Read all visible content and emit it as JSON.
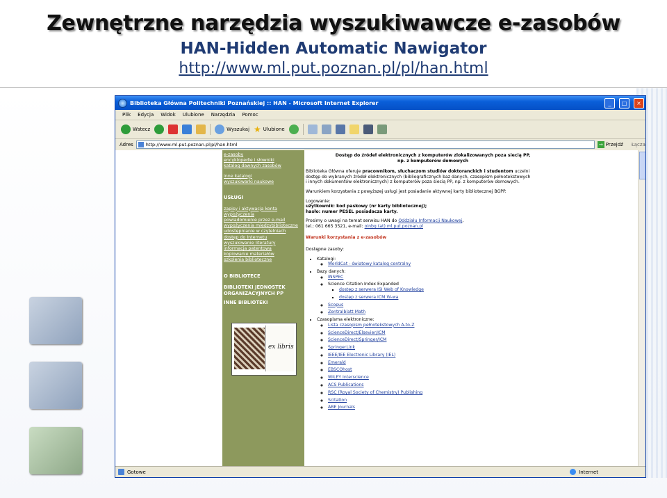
{
  "slide": {
    "title": "Zewnętrzne narzędzia wyszukiwawcze e-zasobów",
    "subtitle": "HAN-Hidden Automatic Nawigator",
    "url": "http://www.ml.put.poznan.pl/pl/han.html"
  },
  "browser": {
    "title": "Biblioteka Główna Politechniki Poznańskiej :: HAN - Microsoft Internet Explorer",
    "menu": [
      "Plik",
      "Edycja",
      "Widok",
      "Ulubione",
      "Narzędzia",
      "Pomoc"
    ],
    "toolbar": {
      "back": "Wstecz",
      "search": "Wyszukaj",
      "favorites": "Ulubione"
    },
    "address_label": "Adres",
    "address_value": "http://www.ml.put.poznan.pl/pl/han.html",
    "go_label": "Przejdź",
    "links_label": "Łącza",
    "status_left": "Gotowe",
    "status_right": "Internet"
  },
  "sidebar": {
    "top_links": [
      "e-zasoby",
      "encyklopedie i słowniki",
      "katalog dawnych zasobów"
    ],
    "mid_links": [
      "inne katalogi",
      "wyszukiwarki naukowe"
    ],
    "uslugi_header": "USŁUGI",
    "uslugi_links": [
      "zapisy i aktywacja konta",
      "wypożyczenia",
      "powiadomienie przez e-mail",
      "wypożyczenia międzybiblioteczne",
      "udostępnianie w czytelniach",
      "dostęp do Internetu",
      "wyszukiwanie literatury",
      "informacja patentowa",
      "kopiowanie materiałów",
      "szkolenia biblioteczne"
    ],
    "section_headers": [
      "O BIBLIOTECE",
      "BIBLIOTEKI JEDNOSTEK ORGANIZACYJNYCH PP",
      "INNE BIBLIOTEKI"
    ],
    "exlibris": "ex libris"
  },
  "content": {
    "notice": "Dostęp do źródeł elektronicznych z komputerów zlokalizowanych poza siecią PP, np. z komputerów domowych",
    "intro_pre": "Biblioteka Główna oferuje ",
    "intro_bold": "pracownikom, słuchaczom studiów doktoranckich i studentom",
    "intro_post": " uczelni dostęp do wybranych źródeł elektronicznych (bibliograficznych baz danych, czasopism pełnotekstowych i innych dokumentów elektronicznych) z komputerów poza siecią PP, np. z komputerów domowych.",
    "condition": "Warunkiem korzystania z powyższej usługi jest posiadanie aktywnej karty bibliotecznej BGPP.",
    "login_label": "Logowanie:",
    "login_user": "użytkownik: kod paskowy (nr karty bibliotecznej);",
    "login_pass": "hasło: numer PESEL posiadacza karty.",
    "contact_pre": "Prosimy o uwagi na temat serwisu HAN do ",
    "contact_link": "Oddziału Informacji Naukowej",
    "contact_tel": "tel.: 061 665 3521, e-mail: ",
    "contact_mail": "oinbg (at) ml.put.poznan.pl",
    "terms_link": "Warunki korzystania z e-zasobów",
    "available_label": "Dostępne zasoby:",
    "catalog_label": "Katalogi:",
    "catalog_item": "WorldCat - światowy katalog centralny",
    "databases_label": "Bazy danych:",
    "db_inspec": "INSPEC",
    "db_sci": "Science Citation Index Expanded",
    "db_sci_sub": [
      "dostęp z serwera ISI Web of Knowledge",
      "dostęp z serwera ICM W-wa"
    ],
    "db_scopus": "Scopus",
    "db_zentral": "Zentralblatt Math",
    "journals_label": "Czasopisma elektroniczne:",
    "journals": [
      "Lista czasopism pełnotekstowych A-to-Z",
      "ScienceDirect/Elsevier/ICM",
      "ScienceDirect/Springer/ICM",
      "SpringerLink",
      "IEEE/IEE Electronic Library (IEL)",
      "Emerald",
      "EBSCOhost",
      "WILEY Interscience",
      "ACS Publications",
      "RSC (Royal Society of Chemistry) Publishing",
      "Scitation",
      "ABE Journals"
    ]
  }
}
